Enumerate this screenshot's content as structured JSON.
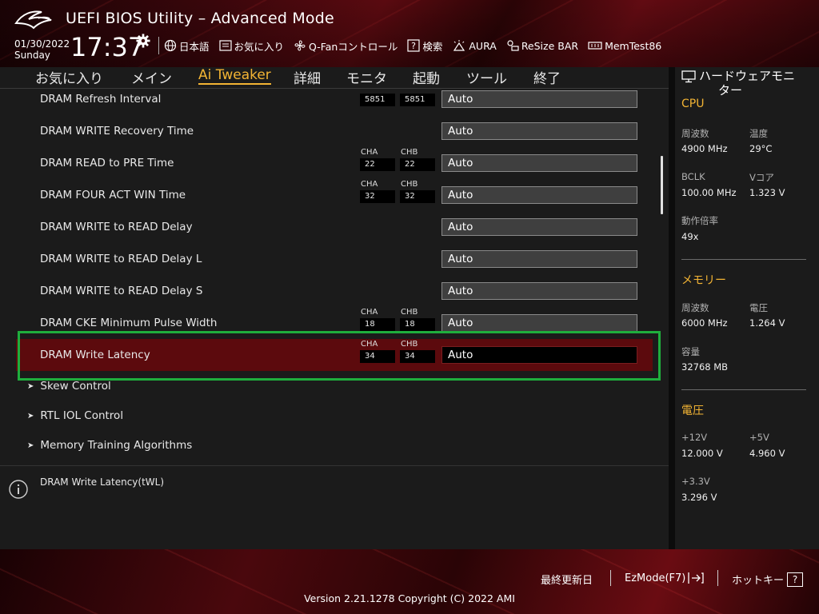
{
  "header": {
    "title": "UEFI BIOS Utility – Advanced Mode",
    "date": "01/30/2022",
    "weekday": "Sunday",
    "time": "17:37",
    "toolbar": {
      "language": "日本語",
      "favorites": "お気に入り",
      "qfan": "Q-Fanコントロール",
      "search": "検索",
      "aura": "AURA",
      "resizebar": "ReSize BAR",
      "memtest": "MemTest86"
    }
  },
  "tabs": {
    "favorites": "お気に入り",
    "main": "メイン",
    "ai_tweaker": "Ai Tweaker",
    "advanced": "詳細",
    "monitor": "モニタ",
    "boot": "起動",
    "tool": "ツール",
    "exit": "終了"
  },
  "active_tab": "Ai Tweaker",
  "settings": [
    {
      "label": "DRAM Refresh Interval",
      "cha_label": "CHA",
      "chb_label": "CHB",
      "cha": "5851",
      "chb": "5851",
      "value": "Auto"
    },
    {
      "label": "DRAM WRITE Recovery Time",
      "value": "Auto"
    },
    {
      "label": "DRAM READ to PRE Time",
      "cha_label": "CHA",
      "chb_label": "CHB",
      "cha": "22",
      "chb": "22",
      "value": "Auto"
    },
    {
      "label": "DRAM FOUR ACT WIN Time",
      "cha_label": "CHA",
      "chb_label": "CHB",
      "cha": "32",
      "chb": "32",
      "value": "Auto"
    },
    {
      "label": "DRAM WRITE to READ Delay",
      "value": "Auto"
    },
    {
      "label": "DRAM WRITE to READ Delay L",
      "value": "Auto"
    },
    {
      "label": "DRAM WRITE to READ Delay S",
      "value": "Auto"
    },
    {
      "label": "DRAM CKE Minimum Pulse Width",
      "cha_label": "CHA",
      "chb_label": "CHB",
      "cha": "18",
      "chb": "18",
      "value": "Auto"
    },
    {
      "label": "DRAM Write Latency",
      "cha_label": "CHA",
      "chb_label": "CHB",
      "cha": "34",
      "chb": "34",
      "value": "Auto"
    }
  ],
  "submenus": [
    "Skew Control",
    "RTL IOL Control",
    "Memory Training Algorithms"
  ],
  "help_text": "DRAM Write Latency(tWL)",
  "hw_monitor": {
    "title_line1": "ハードウェアモニ",
    "title_line2": "ター",
    "cpu": {
      "title": "CPU",
      "freq_label": "周波数",
      "freq": "4900 MHz",
      "temp_label": "温度",
      "temp": "29°C",
      "bclk_label": "BCLK",
      "bclk": "100.00 MHz",
      "vcore_label": "Vコア",
      "vcore": "1.323 V",
      "ratio_label": "動作倍率",
      "ratio": "49x"
    },
    "memory": {
      "title": "メモリー",
      "freq_label": "周波数",
      "freq": "6000 MHz",
      "volt_label": "電圧",
      "volt": "1.264 V",
      "cap_label": "容量",
      "cap": "32768 MB"
    },
    "voltage": {
      "title": "電圧",
      "v12_label": "+12V",
      "v12": "12.000 V",
      "v5_label": "+5V",
      "v5": "4.960 V",
      "v33_label": "+3.3V",
      "v33": "3.296 V"
    }
  },
  "footer": {
    "last_modified": "最終更新日",
    "ezmode": "EzMode(F7)",
    "hotkeys": "ホットキー",
    "hotkey_symbol": "?",
    "version": "Version 2.21.1278 Copyright (C) 2022 AMI"
  },
  "colors": {
    "accent": "#f3b434",
    "selected_row": "#5c0a0d",
    "focus_frame": "#1fae3d"
  }
}
